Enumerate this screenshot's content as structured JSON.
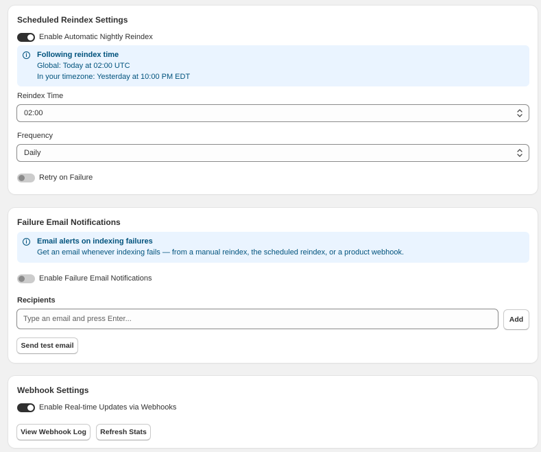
{
  "scheduled_reindex": {
    "title": "Scheduled Reindex Settings",
    "toggle_label": "Enable Automatic Nightly Reindex",
    "toggle_on": true,
    "banner": {
      "title": "Following reindex time",
      "line1": "Global: Today at 02:00 UTC",
      "line2": "In your timezone: Yesterday at 10:00 PM EDT"
    },
    "reindex_time_label": "Reindex Time",
    "reindex_time_value": "02:00",
    "frequency_label": "Frequency",
    "frequency_value": "Daily",
    "retry_label": "Retry on Failure",
    "retry_on": false
  },
  "failure_email": {
    "title": "Failure Email Notifications",
    "banner": {
      "title": "Email alerts on indexing failures",
      "line1": "Get an email whenever indexing fails — from a manual reindex, the scheduled reindex, or a product webhook."
    },
    "toggle_label": "Enable Failure Email Notifications",
    "toggle_on": false,
    "recipients_label": "Recipients",
    "recipients_placeholder": "Type an email and press Enter...",
    "add_label": "Add",
    "send_test_label": "Send test email"
  },
  "webhook": {
    "title": "Webhook Settings",
    "toggle_label": "Enable Real-time Updates via Webhooks",
    "toggle_on": true,
    "view_log_label": "View Webhook Log",
    "refresh_stats_label": "Refresh Stats"
  },
  "icons": {
    "info": "info-circle-icon",
    "select": "chevron-up-down-icon"
  },
  "colors": {
    "page_bg": "#f1f1f1",
    "card_bg": "#ffffff",
    "banner_bg": "#eaf4ff",
    "banner_text": "#00527c",
    "toggle_on": "#303030",
    "toggle_off": "#cccccc"
  }
}
